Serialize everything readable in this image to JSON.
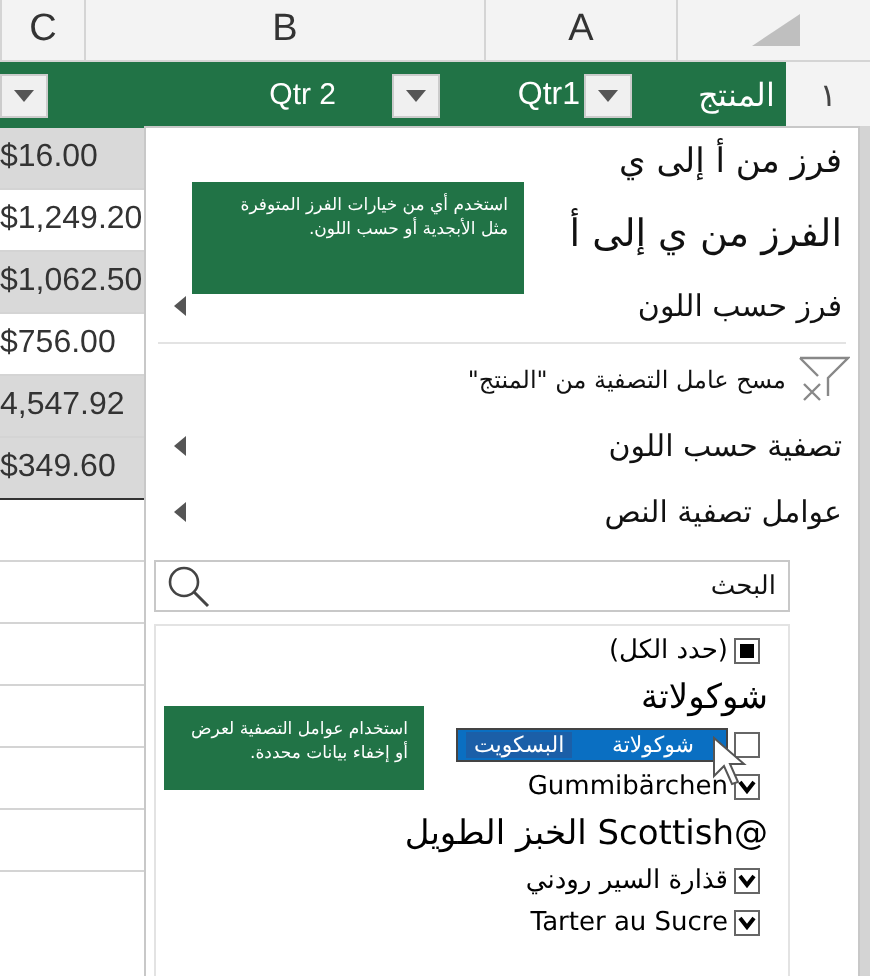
{
  "columns": [
    {
      "label": "A"
    },
    {
      "label": "B"
    },
    {
      "label": "C"
    }
  ],
  "header_row": {
    "number": "١",
    "cells": [
      "المنتج",
      "Qtr1",
      "Qtr 2"
    ]
  },
  "rows": [
    {
      "value": "$16.00",
      "shaded": true
    },
    {
      "value": "$1,249.20",
      "shaded": false
    },
    {
      "value": "$1,062.50",
      "shaded": true
    },
    {
      "value": "$756.00",
      "shaded": false
    },
    {
      "value": "4,547.92",
      "shaded": true
    },
    {
      "value": "$349.60",
      "shaded": true
    }
  ],
  "menu": {
    "items": [
      {
        "kind": "sort",
        "label": "فرز من أ إلى ي"
      },
      {
        "kind": "sort-large",
        "label": "الفرز من ي إلى أ"
      },
      {
        "kind": "submenu",
        "label": "فرز حسب اللون"
      },
      {
        "kind": "divider"
      },
      {
        "kind": "clear",
        "label": "مسح عامل التصفية  من \"المنتج\""
      },
      {
        "kind": "submenu",
        "label": "تصفية حسب اللون"
      },
      {
        "kind": "submenu",
        "label": "عوامل تصفية النص"
      }
    ],
    "search": {
      "placeholder": "البحث"
    },
    "values": [
      {
        "kind": "select-all",
        "label": "(حدد الكل)",
        "checked": true,
        "selected": false
      },
      {
        "kind": "plain",
        "label": "شوكولاتة"
      },
      {
        "kind": "check",
        "label": "شوكولاتة",
        "label_2": "البسكويت",
        "checked": false,
        "selected": true
      },
      {
        "kind": "check",
        "label": "Gummibärchen",
        "checked": true,
        "selected": false
      },
      {
        "kind": "plain",
        "label": "@Scottish الخبز الطويل"
      },
      {
        "kind": "check",
        "label": "قذارة السير رودني",
        "checked": true,
        "selected": false
      },
      {
        "kind": "check",
        "label": "Tarter au Sucre",
        "checked": true,
        "selected": false
      }
    ]
  },
  "tooltips": [
    {
      "text": "استخدم أي من خيارات الفرز المتوفرة مثل الأبجدية أو حسب اللون."
    },
    {
      "text": "استخدام عوامل التصفية لعرض أو إخفاء بيانات محددة."
    }
  ]
}
